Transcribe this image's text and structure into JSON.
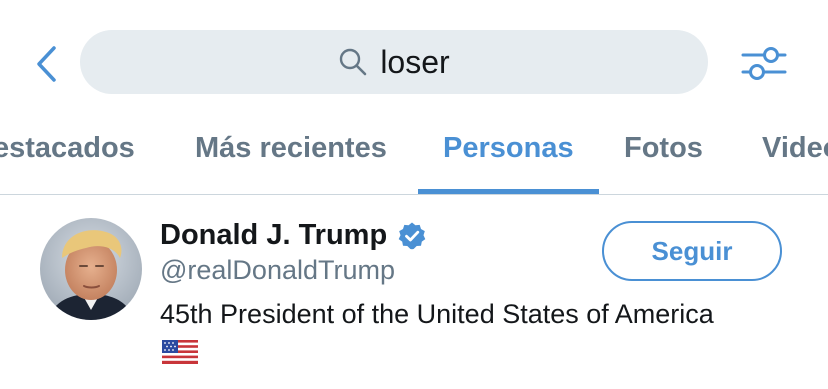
{
  "search": {
    "query": "loser"
  },
  "tabs": [
    {
      "label": "Destacados",
      "active": false
    },
    {
      "label": "Más recientes",
      "active": false
    },
    {
      "label": "Personas",
      "active": true
    },
    {
      "label": "Fotos",
      "active": false
    },
    {
      "label": "Videos",
      "active": false
    }
  ],
  "results": [
    {
      "display_name": "Donald J. Trump",
      "verified": true,
      "handle": "@realDonaldTrump",
      "bio": "45th President of the United States of America",
      "bio_emoji": "us-flag-icon",
      "follow_label": "Seguir"
    }
  ],
  "colors": {
    "accent": "#4a90d4",
    "search_bg": "#e6ecf0",
    "muted_text": "#657786",
    "primary_text": "#14171a",
    "divider": "#ccd6dd"
  },
  "icons": {
    "back": "chevron-left-icon",
    "search": "search-icon",
    "filter": "filter-sliders-icon",
    "verified": "verified-badge-icon"
  }
}
